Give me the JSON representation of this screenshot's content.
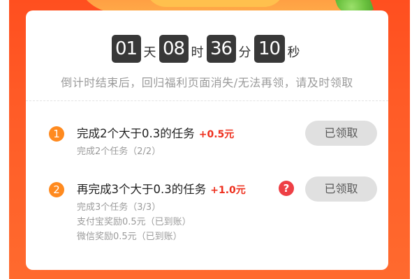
{
  "countdown": {
    "days": "01",
    "days_unit": "天",
    "hours": "08",
    "hours_unit": "时",
    "minutes": "36",
    "minutes_unit": "分",
    "seconds": "10",
    "seconds_unit": "秒"
  },
  "notice": "倒计时结束后，回归福利页面消失/无法再领，请及时领取",
  "tasks": [
    {
      "index": "1",
      "title": "完成2个大于0.3的任务",
      "reward": "+0.5元",
      "button_label": "已领取",
      "details": [
        "完成2个任务（2/2）"
      ]
    },
    {
      "index": "2",
      "title": "再完成3个大于0.3的任务",
      "reward": "+1.0元",
      "help_icon": "?",
      "button_label": "已领取",
      "details": [
        "完成3个任务（3/3）",
        "支付宝奖励0.5元（已到账）",
        "微信奖励0.5元（已到账）"
      ]
    }
  ],
  "colors": {
    "background": "#ff5c27",
    "reward": "#ee2f1d",
    "badge": "#ff8a1f",
    "button_disabled": "#e0e0e0",
    "time_box": "#383838"
  },
  "icons": {
    "help": "question-circle-icon",
    "leaf": "leaf-icon"
  }
}
